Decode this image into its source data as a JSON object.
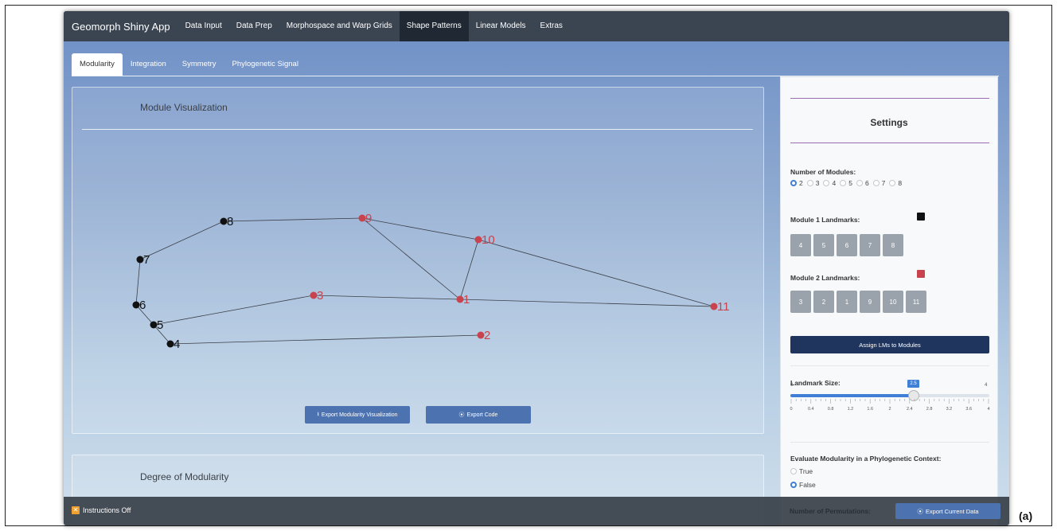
{
  "navbar": {
    "brand": "Geomorph Shiny App",
    "items": [
      "Data Input",
      "Data Prep",
      "Morphospace and Warp Grids",
      "Shape Patterns",
      "Linear Models",
      "Extras"
    ],
    "active": "Shape Patterns"
  },
  "tabs": {
    "items": [
      "Modularity",
      "Integration",
      "Symmetry",
      "Phylogenetic Signal"
    ],
    "active": "Modularity"
  },
  "viz": {
    "title": "Module Visualization",
    "export_viz_label": "Export Modularity Visualization",
    "export_code_label": "Export Code",
    "landmarks": [
      {
        "id": "1",
        "module": 2
      },
      {
        "id": "2",
        "module": 2
      },
      {
        "id": "3",
        "module": 2
      },
      {
        "id": "4",
        "module": 1
      },
      {
        "id": "5",
        "module": 1
      },
      {
        "id": "6",
        "module": 1
      },
      {
        "id": "7",
        "module": 1
      },
      {
        "id": "8",
        "module": 1
      },
      {
        "id": "9",
        "module": 2
      },
      {
        "id": "10",
        "module": 2
      },
      {
        "id": "11",
        "module": 2
      }
    ],
    "module_colors": {
      "1": "#111111",
      "2": "#c9434e"
    }
  },
  "modularity": {
    "title": "Degree of Modularity"
  },
  "settings": {
    "title": "Settings",
    "num_modules_label": "Number of Modules:",
    "num_modules_options": [
      "2",
      "3",
      "4",
      "5",
      "6",
      "7",
      "8"
    ],
    "num_modules_selected": "2",
    "module1_label": "Module 1 Landmarks:",
    "module1_color": "#111111",
    "module1_landmarks": [
      "4",
      "5",
      "6",
      "7",
      "8"
    ],
    "module2_label": "Module 2 Landmarks:",
    "module2_color": "#c9434e",
    "module2_landmarks": [
      "3",
      "2",
      "1",
      "9",
      "10",
      "11"
    ],
    "assign_label": "Assign LMs to Modules",
    "landmark_size_label": "Landmark Size:",
    "landmark_size_min": "0",
    "landmark_size_max": "4",
    "landmark_size_value": "2.5",
    "landmark_size_ticks": [
      "0",
      "0.4",
      "0.8",
      "1.2",
      "1.6",
      "2",
      "2.4",
      "2.8",
      "3.2",
      "3.6",
      "4"
    ],
    "phylo_label": "Evaluate Modularity in a Phylogenetic Context:",
    "phylo_options": [
      "True",
      "False"
    ],
    "phylo_selected": "False",
    "permutations_label": "Number of Permutations:"
  },
  "footer": {
    "instructions_label": "Instructions Off",
    "export_data_label": "Export Current Data"
  },
  "caption": "(a)"
}
